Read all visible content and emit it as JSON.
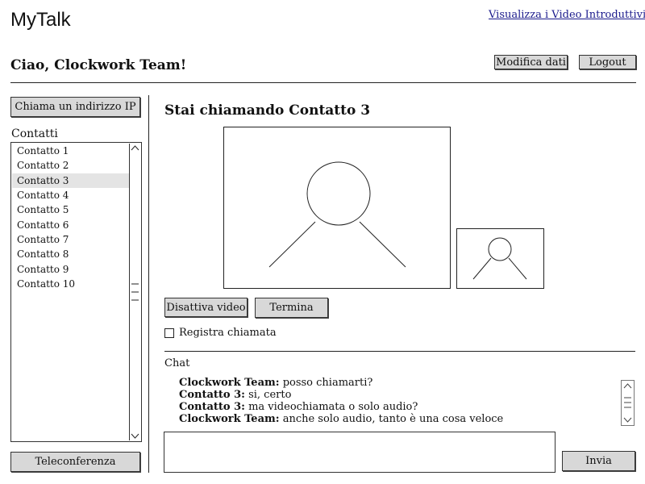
{
  "header": {
    "app_title": "MyTalk",
    "intro_link": "Visualizza i Video Introduttivi",
    "greeting": "Ciao, Clockwork Team!",
    "edit_button": "Modifica dati",
    "logout_button": "Logout"
  },
  "sidebar": {
    "call_ip_button": "Chiama un indirizzo IP",
    "contacts_label": "Contatti",
    "contacts": [
      {
        "label": "Contatto 1",
        "selected": false
      },
      {
        "label": "Contatto 2",
        "selected": false
      },
      {
        "label": "Contatto 3",
        "selected": true
      },
      {
        "label": "Contatto 4",
        "selected": false
      },
      {
        "label": "Contatto 5",
        "selected": false
      },
      {
        "label": "Contatto 6",
        "selected": false
      },
      {
        "label": "Contatto 7",
        "selected": false
      },
      {
        "label": "Contatto 8",
        "selected": false
      },
      {
        "label": "Contatto 9",
        "selected": false
      },
      {
        "label": "Contatto 10",
        "selected": false
      }
    ],
    "conference_button": "Teleconferenza"
  },
  "call": {
    "title": "Stai chiamando Contatto 3",
    "disable_video_button": "Disattiva video",
    "end_button": "Termina",
    "record_label": "Registra chiamata",
    "record_checked": false
  },
  "chat": {
    "label": "Chat",
    "messages": [
      {
        "sender": "Clockwork Team:",
        "text": " posso chiamarti?"
      },
      {
        "sender": "Contatto 3:",
        "text": " si, certo"
      },
      {
        "sender": "Contatto 3:",
        "text": " ma videochiamata o solo audio?"
      },
      {
        "sender": "Clockwork Team:",
        "text": " anche solo audio, tanto è una cosa veloce"
      }
    ],
    "input_value": "",
    "send_button": "Invia"
  }
}
